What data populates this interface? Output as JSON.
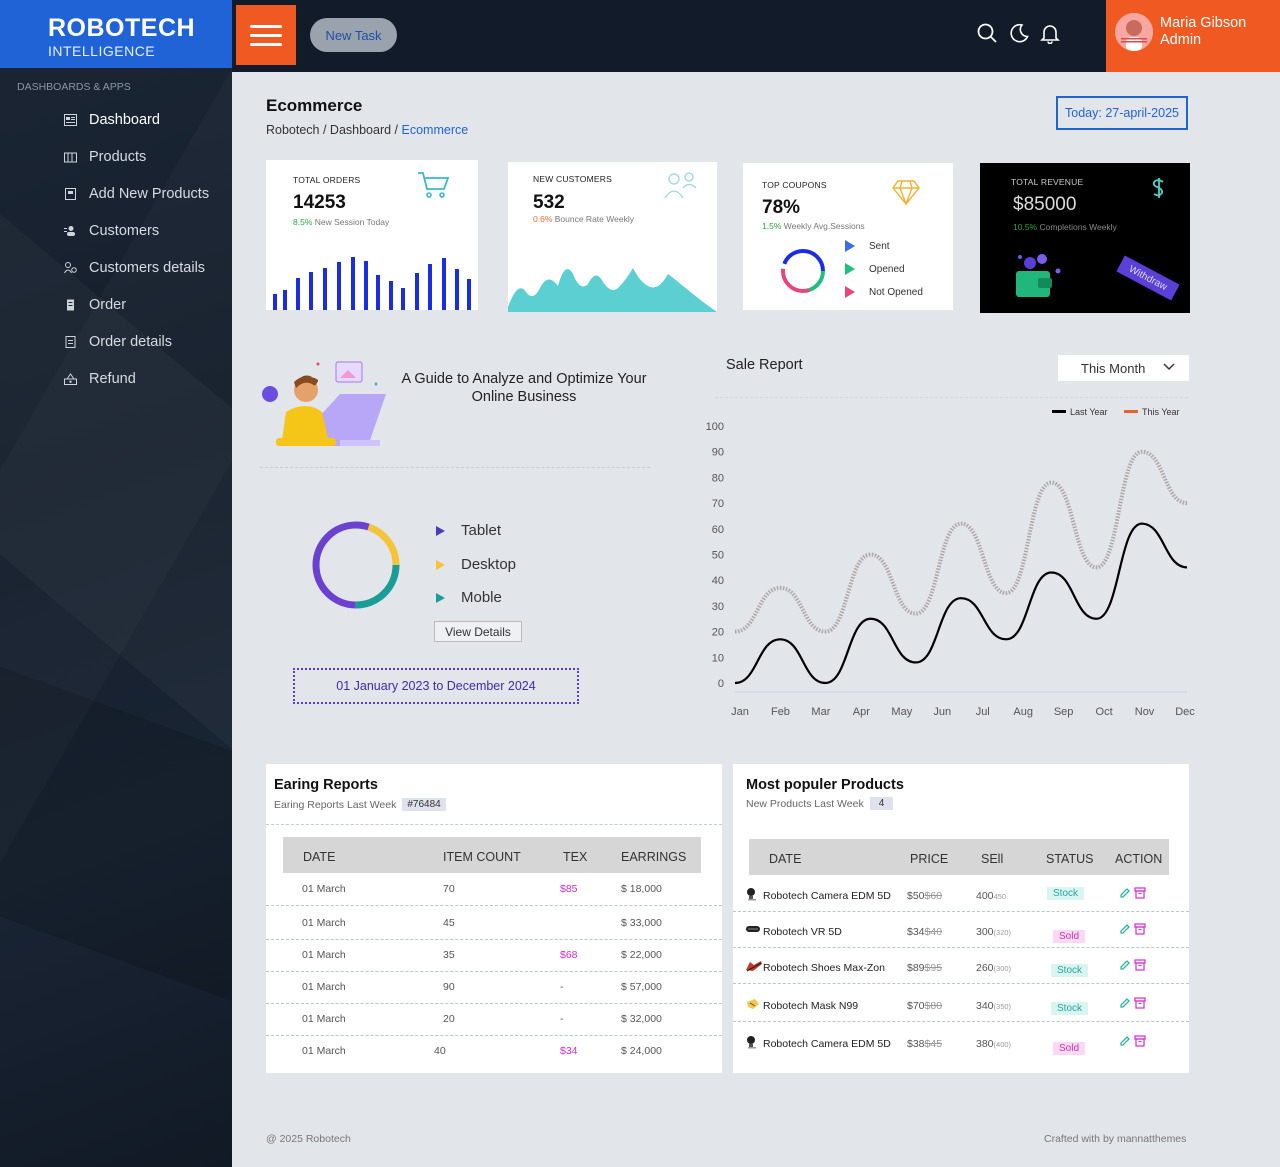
{
  "brand": {
    "name": "ROBOTECH",
    "sub": "INTELLIGENCE"
  },
  "sidebar": {
    "section": "DASHBOARDS & APPS",
    "items": [
      {
        "label": "Dashboard",
        "icon": "dashboard-icon"
      },
      {
        "label": "Products",
        "icon": "products-icon"
      },
      {
        "label": "Add New Products",
        "icon": "add-product-icon"
      },
      {
        "label": "Customers",
        "icon": "customers-icon"
      },
      {
        "label": "Customers details",
        "icon": "customer-details-icon"
      },
      {
        "label": "Order",
        "icon": "order-icon"
      },
      {
        "label": "Order details",
        "icon": "order-details-icon"
      },
      {
        "label": "Refund",
        "icon": "refund-icon"
      }
    ]
  },
  "topbar": {
    "new_task": "New Task",
    "user_name": "Maria Gibson",
    "user_role": "Admin",
    "accent": "#f05a22"
  },
  "header": {
    "title": "Ecommerce",
    "crumb1": "Robotech / Dashboard / ",
    "crumb_current": "Ecommerce",
    "today": "Today: 27-april-2025"
  },
  "cards": {
    "orders": {
      "label": "TOTAL ORDERS",
      "value": "14253",
      "pct": "8.5%",
      "note": " New Session Today"
    },
    "customers": {
      "label": "NEW CUSTOMERS",
      "value": "532",
      "pct": "0.6%",
      "note": " Bounce Rate Weekly"
    },
    "coupons": {
      "label": "TOP COUPONS",
      "value": "78%",
      "pct": "1.5%",
      "note": " Weekly Avg.Sessions",
      "legend": [
        "Sent",
        "Opened",
        "Not Opened"
      ]
    },
    "revenue": {
      "label": "TOTAL REVENUE",
      "value": "$85000",
      "pct": "10.5%",
      "note": " Completions Weekly",
      "withdraw": "Withdraw"
    }
  },
  "guide": {
    "title": "A Guide to Analyze and Optimize Your Online Business",
    "legend": [
      "Tablet",
      "Desktop",
      "Moble"
    ],
    "view_details": "View Details",
    "date_range": "01 January 2023 to December 2024"
  },
  "sale": {
    "title": "Sale Report",
    "period": "This Month"
  },
  "chart_data": {
    "type": "line",
    "title": "",
    "categories": [
      "Jan",
      "Feb",
      "Mar",
      "Apr",
      "May",
      "Jun",
      "Jul",
      "Aug",
      "Sep",
      "Oct",
      "Nov",
      "Dec"
    ],
    "ylim": [
      0,
      100
    ],
    "yticks": [
      0,
      10,
      20,
      30,
      40,
      50,
      60,
      70,
      80,
      90,
      100
    ],
    "series": [
      {
        "name": "Last Year",
        "color": "#000000",
        "values": [
          0,
          17,
          0,
          25,
          8,
          33,
          17,
          43,
          25,
          62,
          45
        ]
      },
      {
        "name": "This Year",
        "color": "#e8622a",
        "values": [
          20,
          37,
          20,
          50,
          27,
          62,
          35,
          78,
          45,
          90,
          70
        ]
      }
    ],
    "grid": false,
    "legend": "top-right"
  },
  "earning": {
    "title": "Earing Reports",
    "sub": "Earing Reports Last Week",
    "tag": "#76484",
    "columns": [
      "DATE",
      "ITEM COUNT",
      "TEX",
      "EARRINGS"
    ],
    "rows": [
      [
        "01 March",
        "70",
        "$85",
        "$ 18,000"
      ],
      [
        "01 March",
        "45",
        "",
        "$ 33,000"
      ],
      [
        "01 March",
        "35",
        "$68",
        "$ 22,000"
      ],
      [
        "01 March",
        "90",
        "-",
        "$ 57,000"
      ],
      [
        "01 March",
        "20",
        "-",
        "$ 32,000"
      ],
      [
        "01 March",
        "40",
        "$34",
        "$ 24,000"
      ]
    ]
  },
  "products": {
    "title": "Most populer Products",
    "sub": "New Products Last Week",
    "tag": "4",
    "columns": [
      "DATE",
      "PRICE",
      "SEll",
      "STATUS",
      "ACTION"
    ],
    "rows": [
      {
        "name": "Robotech Camera EDM 5D",
        "price": "$50",
        "old": "$60",
        "sell": "400",
        "sell_small": "450",
        "status": "Stock"
      },
      {
        "name": "Robotech VR 5D",
        "price": "$34",
        "old": "$40",
        "sell": "300",
        "sell_small": "(320)",
        "status": "Sold"
      },
      {
        "name": "Robotech Shoes Max-Zon",
        "price": "$89",
        "old": "$95",
        "sell": "260",
        "sell_small": "(300)",
        "status": "Stock"
      },
      {
        "name": "Robotech Mask N99",
        "price": "$70",
        "old": "$80",
        "sell": "340",
        "sell_small": "(350)",
        "status": "Stock"
      },
      {
        "name": "Robotech Camera EDM 5D",
        "price": "$38",
        "old": "$45",
        "sell": "380",
        "sell_small": "(400)",
        "status": "Sold"
      }
    ]
  },
  "footer": {
    "left": "@ 2025  Robotech",
    "right": "Crafted with by mannatthemes"
  }
}
